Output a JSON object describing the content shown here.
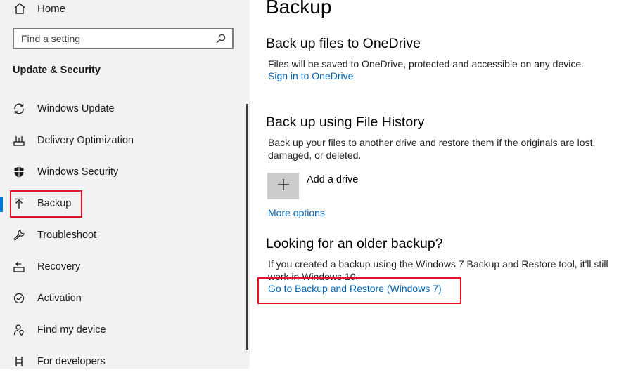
{
  "sidebar": {
    "home_label": "Home",
    "search_placeholder": "Find a setting",
    "section_heading": "Update & Security",
    "items": [
      {
        "label": "Windows Update",
        "icon": "refresh-icon"
      },
      {
        "label": "Delivery Optimization",
        "icon": "delivery-optimization-icon"
      },
      {
        "label": "Windows Security",
        "icon": "shield-icon"
      },
      {
        "label": "Backup",
        "icon": "upload-arrow-icon",
        "active": true
      },
      {
        "label": "Troubleshoot",
        "icon": "wrench-icon"
      },
      {
        "label": "Recovery",
        "icon": "recovery-icon"
      },
      {
        "label": "Activation",
        "icon": "activation-icon"
      },
      {
        "label": "Find my device",
        "icon": "person-pin-icon"
      },
      {
        "label": "For developers",
        "icon": "developer-icon"
      }
    ]
  },
  "main": {
    "title": "Backup",
    "onedrive": {
      "heading": "Back up files to OneDrive",
      "description": "Files will be saved to OneDrive, protected and accessible on any device.",
      "link": "Sign in to OneDrive"
    },
    "file_history": {
      "heading": "Back up using File History",
      "description": "Back up your files to another drive and restore them if the originals are lost, damaged, or deleted.",
      "add_drive_label": "Add a drive",
      "more_options": "More options"
    },
    "older_backup": {
      "heading": "Looking for an older backup?",
      "description": "If you created a backup using the Windows 7 Backup and Restore tool, it'll still work in Windows 10.",
      "link": "Go to Backup and Restore (Windows 7)"
    }
  },
  "colors": {
    "accent": "#0078d7",
    "link": "#0063b1",
    "highlight": "#e81123",
    "sidebar_bg": "#f2f2f2"
  }
}
